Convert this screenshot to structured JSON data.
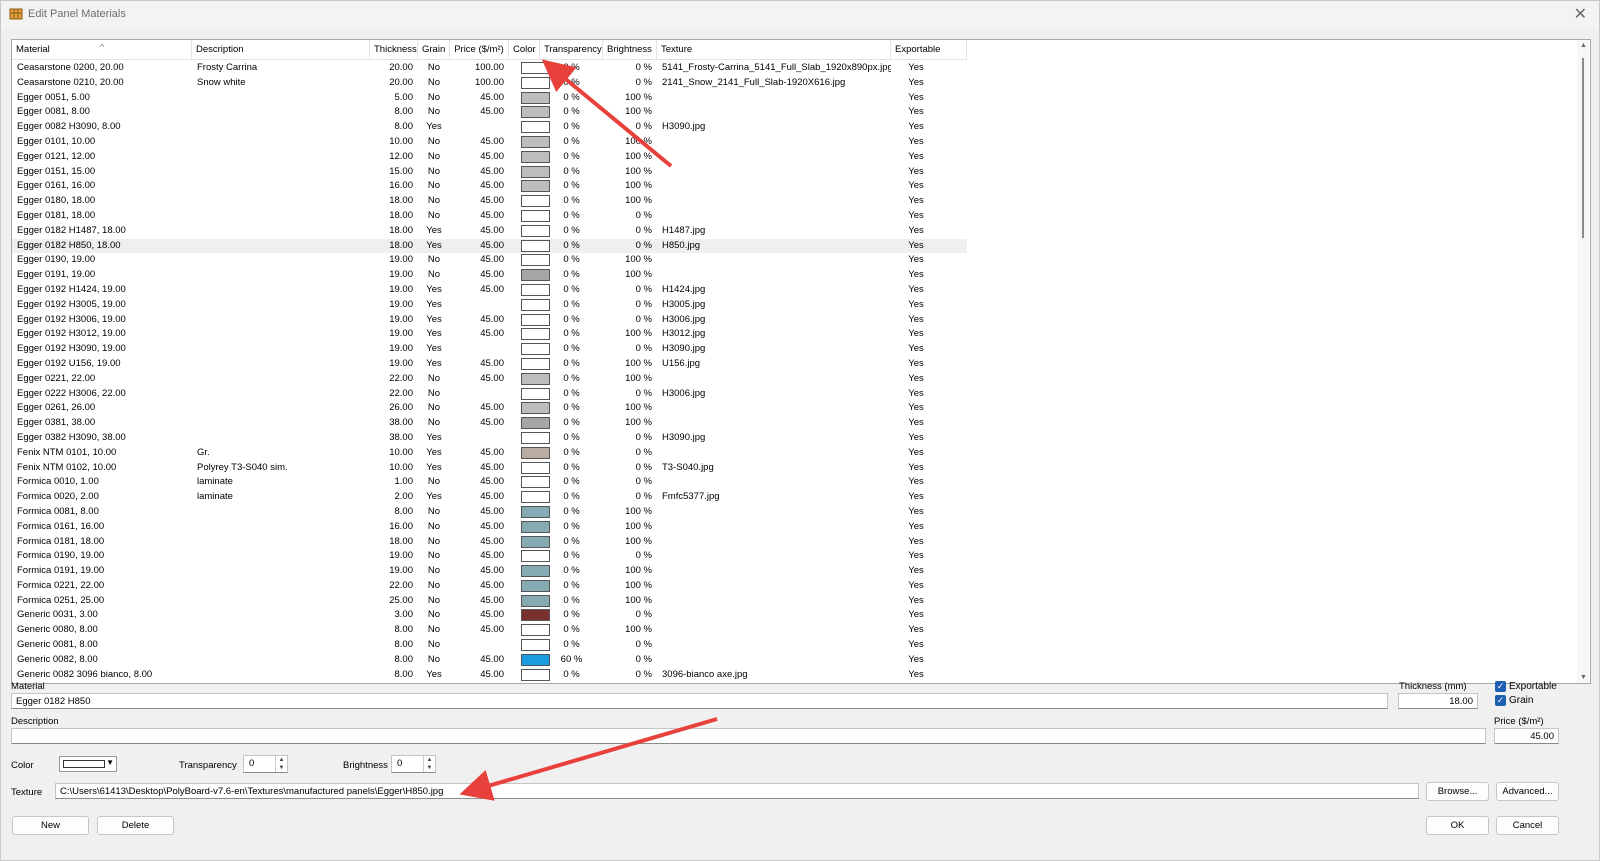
{
  "window": {
    "title": "Edit Panel Materials"
  },
  "columns": [
    "Material",
    "Description",
    "Thickness",
    "Grain",
    "Price ($/m²)",
    "Color",
    "Transparency",
    "Brightness",
    "Texture",
    "Exportable"
  ],
  "rows": [
    {
      "material": "Ceasarstone 0200, 20.00",
      "description": "Frosty Carrina",
      "thickness": "20.00",
      "grain": "No",
      "price": "100.00",
      "color": "#ffffff",
      "transparency": "0 %",
      "brightness": "0 %",
      "texture": "5141_Frosty-Carrina_5141_Full_Slab_1920x890px.jpg",
      "exportable": "Yes"
    },
    {
      "material": "Ceasarstone 0210, 20.00",
      "description": "Snow white",
      "thickness": "20.00",
      "grain": "No",
      "price": "100.00",
      "color": "#ffffff",
      "transparency": "0 %",
      "brightness": "0 %",
      "texture": "2141_Snow_2141_Full_Slab-1920X616.jpg",
      "exportable": "Yes"
    },
    {
      "material": "Egger 0051, 5.00",
      "description": "",
      "thickness": "5.00",
      "grain": "No",
      "price": "45.00",
      "color": "#bdbdbd",
      "transparency": "0 %",
      "brightness": "100 %",
      "texture": "",
      "exportable": "Yes"
    },
    {
      "material": "Egger 0081, 8.00",
      "description": "",
      "thickness": "8.00",
      "grain": "No",
      "price": "45.00",
      "color": "#bdbdbd",
      "transparency": "0 %",
      "brightness": "100 %",
      "texture": "",
      "exportable": "Yes"
    },
    {
      "material": "Egger 0082 H3090, 8.00",
      "description": "",
      "thickness": "8.00",
      "grain": "Yes",
      "price": "",
      "color": "#ffffff",
      "transparency": "0 %",
      "brightness": "0 %",
      "texture": "H3090.jpg",
      "exportable": "Yes"
    },
    {
      "material": "Egger 0101, 10.00",
      "description": "",
      "thickness": "10.00",
      "grain": "No",
      "price": "45.00",
      "color": "#bdbdbd",
      "transparency": "0 %",
      "brightness": "100 %",
      "texture": "",
      "exportable": "Yes"
    },
    {
      "material": "Egger 0121, 12.00",
      "description": "",
      "thickness": "12.00",
      "grain": "No",
      "price": "45.00",
      "color": "#bdbdbd",
      "transparency": "0 %",
      "brightness": "100 %",
      "texture": "",
      "exportable": "Yes"
    },
    {
      "material": "Egger 0151, 15.00",
      "description": "",
      "thickness": "15.00",
      "grain": "No",
      "price": "45.00",
      "color": "#bdbdbd",
      "transparency": "0 %",
      "brightness": "100 %",
      "texture": "",
      "exportable": "Yes"
    },
    {
      "material": "Egger 0161, 16.00",
      "description": "",
      "thickness": "16.00",
      "grain": "No",
      "price": "45.00",
      "color": "#bdbdbd",
      "transparency": "0 %",
      "brightness": "100 %",
      "texture": "",
      "exportable": "Yes"
    },
    {
      "material": "Egger 0180, 18.00",
      "description": "",
      "thickness": "18.00",
      "grain": "No",
      "price": "45.00",
      "color": "#ffffff",
      "transparency": "0 %",
      "brightness": "100 %",
      "texture": "",
      "exportable": "Yes"
    },
    {
      "material": "Egger 0181, 18.00",
      "description": "",
      "thickness": "18.00",
      "grain": "No",
      "price": "45.00",
      "color": "#ffffff",
      "transparency": "0 %",
      "brightness": "0 %",
      "texture": "",
      "exportable": "Yes"
    },
    {
      "material": "Egger 0182 H1487, 18.00",
      "description": "",
      "thickness": "18.00",
      "grain": "Yes",
      "price": "45.00",
      "color": "#ffffff",
      "transparency": "0 %",
      "brightness": "0 %",
      "texture": "H1487.jpg",
      "exportable": "Yes"
    },
    {
      "material": "Egger 0182 H850, 18.00",
      "description": "",
      "thickness": "18.00",
      "grain": "Yes",
      "price": "45.00",
      "color": "#ffffff",
      "transparency": "0 %",
      "brightness": "0 %",
      "texture": "H850.jpg",
      "exportable": "Yes",
      "selected": true
    },
    {
      "material": "Egger 0190, 19.00",
      "description": "",
      "thickness": "19.00",
      "grain": "No",
      "price": "45.00",
      "color": "#ffffff",
      "transparency": "0 %",
      "brightness": "100 %",
      "texture": "",
      "exportable": "Yes"
    },
    {
      "material": "Egger 0191, 19.00",
      "description": "",
      "thickness": "19.00",
      "grain": "No",
      "price": "45.00",
      "color": "#a6a6a6",
      "transparency": "0 %",
      "brightness": "100 %",
      "texture": "",
      "exportable": "Yes"
    },
    {
      "material": "Egger 0192 H1424, 19.00",
      "description": "",
      "thickness": "19.00",
      "grain": "Yes",
      "price": "45.00",
      "color": "#ffffff",
      "transparency": "0 %",
      "brightness": "0 %",
      "texture": "H1424.jpg",
      "exportable": "Yes"
    },
    {
      "material": "Egger 0192 H3005, 19.00",
      "description": "",
      "thickness": "19.00",
      "grain": "Yes",
      "price": "",
      "color": "#ffffff",
      "transparency": "0 %",
      "brightness": "0 %",
      "texture": "H3005.jpg",
      "exportable": "Yes"
    },
    {
      "material": "Egger 0192 H3006, 19.00",
      "description": "",
      "thickness": "19.00",
      "grain": "Yes",
      "price": "45.00",
      "color": "#ffffff",
      "transparency": "0 %",
      "brightness": "0 %",
      "texture": "H3006.jpg",
      "exportable": "Yes"
    },
    {
      "material": "Egger 0192 H3012, 19.00",
      "description": "",
      "thickness": "19.00",
      "grain": "Yes",
      "price": "45.00",
      "color": "#ffffff",
      "transparency": "0 %",
      "brightness": "100 %",
      "texture": "H3012.jpg",
      "exportable": "Yes"
    },
    {
      "material": "Egger 0192 H3090, 19.00",
      "description": "",
      "thickness": "19.00",
      "grain": "Yes",
      "price": "",
      "color": "#ffffff",
      "transparency": "0 %",
      "brightness": "0 %",
      "texture": "H3090.jpg",
      "exportable": "Yes"
    },
    {
      "material": "Egger 0192 U156, 19.00",
      "description": "",
      "thickness": "19.00",
      "grain": "Yes",
      "price": "45.00",
      "color": "#ffffff",
      "transparency": "0 %",
      "brightness": "100 %",
      "texture": "U156.jpg",
      "exportable": "Yes"
    },
    {
      "material": "Egger 0221, 22.00",
      "description": "",
      "thickness": "22.00",
      "grain": "No",
      "price": "45.00",
      "color": "#bdbdbd",
      "transparency": "0 %",
      "brightness": "100 %",
      "texture": "",
      "exportable": "Yes"
    },
    {
      "material": "Egger 0222 H3006, 22.00",
      "description": "",
      "thickness": "22.00",
      "grain": "No",
      "price": "",
      "color": "#ffffff",
      "transparency": "0 %",
      "brightness": "0 %",
      "texture": "H3006.jpg",
      "exportable": "Yes"
    },
    {
      "material": "Egger 0261, 26.00",
      "description": "",
      "thickness": "26.00",
      "grain": "No",
      "price": "45.00",
      "color": "#bdbdbd",
      "transparency": "0 %",
      "brightness": "100 %",
      "texture": "",
      "exportable": "Yes"
    },
    {
      "material": "Egger 0381, 38.00",
      "description": "",
      "thickness": "38.00",
      "grain": "No",
      "price": "45.00",
      "color": "#a6a6a6",
      "transparency": "0 %",
      "brightness": "100 %",
      "texture": "",
      "exportable": "Yes"
    },
    {
      "material": "Egger 0382 H3090, 38.00",
      "description": "",
      "thickness": "38.00",
      "grain": "Yes",
      "price": "",
      "color": "#ffffff",
      "transparency": "0 %",
      "brightness": "0 %",
      "texture": "H3090.jpg",
      "exportable": "Yes"
    },
    {
      "material": "Fenix NTM 0101, 10.00",
      "description": "Gr.",
      "thickness": "10.00",
      "grain": "Yes",
      "price": "45.00",
      "color": "#b9aca3",
      "transparency": "0 %",
      "brightness": "0 %",
      "texture": "",
      "exportable": "Yes"
    },
    {
      "material": "Fenix NTM 0102, 10.00",
      "description": "Polyrey T3-S040 sim.",
      "thickness": "10.00",
      "grain": "Yes",
      "price": "45.00",
      "color": "#ffffff",
      "transparency": "0 %",
      "brightness": "0 %",
      "texture": "T3-S040.jpg",
      "exportable": "Yes"
    },
    {
      "material": "Formica 0010, 1.00",
      "description": "laminate",
      "thickness": "1.00",
      "grain": "No",
      "price": "45.00",
      "color": "#ffffff",
      "transparency": "0 %",
      "brightness": "0 %",
      "texture": "",
      "exportable": "Yes"
    },
    {
      "material": "Formica 0020, 2.00",
      "description": "laminate",
      "thickness": "2.00",
      "grain": "Yes",
      "price": "45.00",
      "color": "#ffffff",
      "transparency": "0 %",
      "brightness": "0 %",
      "texture": "Fmfc5377.jpg",
      "exportable": "Yes"
    },
    {
      "material": "Formica 0081, 8.00",
      "description": "",
      "thickness": "8.00",
      "grain": "No",
      "price": "45.00",
      "color": "#86aab2",
      "transparency": "0 %",
      "brightness": "100 %",
      "texture": "",
      "exportable": "Yes"
    },
    {
      "material": "Formica 0161, 16.00",
      "description": "",
      "thickness": "16.00",
      "grain": "No",
      "price": "45.00",
      "color": "#86aab2",
      "transparency": "0 %",
      "brightness": "100 %",
      "texture": "",
      "exportable": "Yes"
    },
    {
      "material": "Formica 0181, 18.00",
      "description": "",
      "thickness": "18.00",
      "grain": "No",
      "price": "45.00",
      "color": "#86aab2",
      "transparency": "0 %",
      "brightness": "100 %",
      "texture": "",
      "exportable": "Yes"
    },
    {
      "material": "Formica 0190, 19.00",
      "description": "",
      "thickness": "19.00",
      "grain": "No",
      "price": "45.00",
      "color": "#ffffff",
      "transparency": "0 %",
      "brightness": "0 %",
      "texture": "",
      "exportable": "Yes"
    },
    {
      "material": "Formica 0191, 19.00",
      "description": "",
      "thickness": "19.00",
      "grain": "No",
      "price": "45.00",
      "color": "#86aab2",
      "transparency": "0 %",
      "brightness": "100 %",
      "texture": "",
      "exportable": "Yes"
    },
    {
      "material": "Formica 0221, 22.00",
      "description": "",
      "thickness": "22.00",
      "grain": "No",
      "price": "45.00",
      "color": "#86aab2",
      "transparency": "0 %",
      "brightness": "100 %",
      "texture": "",
      "exportable": "Yes"
    },
    {
      "material": "Formica 0251, 25.00",
      "description": "",
      "thickness": "25.00",
      "grain": "No",
      "price": "45.00",
      "color": "#86aab2",
      "transparency": "0 %",
      "brightness": "100 %",
      "texture": "",
      "exportable": "Yes"
    },
    {
      "material": "Generic 0031, 3.00",
      "description": "",
      "thickness": "3.00",
      "grain": "No",
      "price": "45.00",
      "color": "#7b3030",
      "transparency": "0 %",
      "brightness": "0 %",
      "texture": "",
      "exportable": "Yes"
    },
    {
      "material": "Generic 0080, 8.00",
      "description": "",
      "thickness": "8.00",
      "grain": "No",
      "price": "45.00",
      "color": "#ffffff",
      "transparency": "0 %",
      "brightness": "100 %",
      "texture": "",
      "exportable": "Yes"
    },
    {
      "material": "Generic 0081, 8.00",
      "description": "",
      "thickness": "8.00",
      "grain": "No",
      "price": "",
      "color": "#ffffff",
      "transparency": "0 %",
      "brightness": "0 %",
      "texture": "",
      "exportable": "Yes"
    },
    {
      "material": "Generic 0082, 8.00",
      "description": "",
      "thickness": "8.00",
      "grain": "No",
      "price": "45.00",
      "color": "#1a9de0",
      "transparency": "60 %",
      "brightness": "0 %",
      "texture": "",
      "exportable": "Yes"
    },
    {
      "material": "Generic 0082 3096 bianco, 8.00",
      "description": "",
      "thickness": "8.00",
      "grain": "Yes",
      "price": "45.00",
      "color": "#ffffff",
      "transparency": "0 %",
      "brightness": "0 %",
      "texture": "3096-bianco axe.jpg",
      "exportable": "Yes"
    }
  ],
  "form": {
    "material_label": "Material",
    "material_value": "Egger 0182 H850",
    "thickness_label": "Thickness (mm)",
    "thickness_value": "18.00",
    "exportable_label": "Exportable",
    "grain_label": "Grain",
    "description_label": "Description",
    "description_value": "",
    "price_label": "Price ($/m²)",
    "price_value": "45.00",
    "color_label": "Color",
    "transparency_label": "Transparency",
    "transparency_value": "0",
    "brightness_label": "Brightness",
    "brightness_value": "0",
    "texture_label": "Texture",
    "texture_value": "C:\\Users\\61413\\Desktop\\PolyBoard-v7.6-en\\Textures\\manufactured panels\\Egger\\H850.jpg"
  },
  "buttons": {
    "browse": "Browse...",
    "advanced": "Advanced...",
    "new": "New",
    "delete": "Delete",
    "ok": "OK",
    "cancel": "Cancel"
  },
  "colors": {
    "accent": "#1e5fb4",
    "annotation_arrow": "#e8413c"
  }
}
